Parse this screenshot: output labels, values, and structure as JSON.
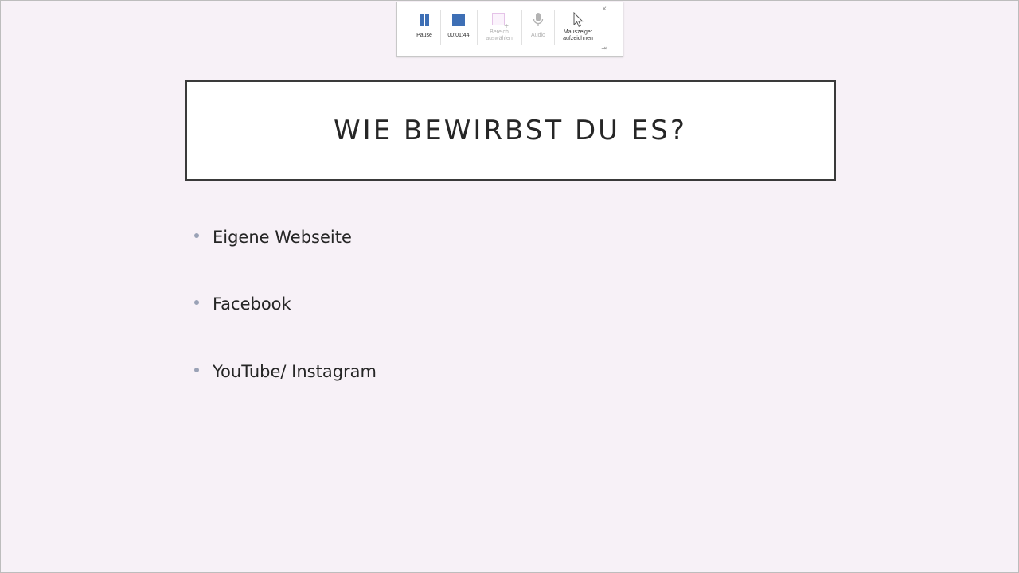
{
  "toolbar": {
    "pause_label": "Pause",
    "timer": "00:01:44",
    "area_label": "Bereich\nauswählen",
    "audio_label": "Audio",
    "cursor_label": "Mauszeiger\naufzeichnen",
    "close_glyph": "×",
    "pin_glyph": "⇥",
    "accent_color": "#3e6fb5"
  },
  "slide": {
    "title": "Wie bewirbst du es?",
    "bullets": [
      "Eigene Webseite",
      "Facebook",
      "YouTube/ Instagram"
    ],
    "background_color": "#f7f1f7"
  }
}
